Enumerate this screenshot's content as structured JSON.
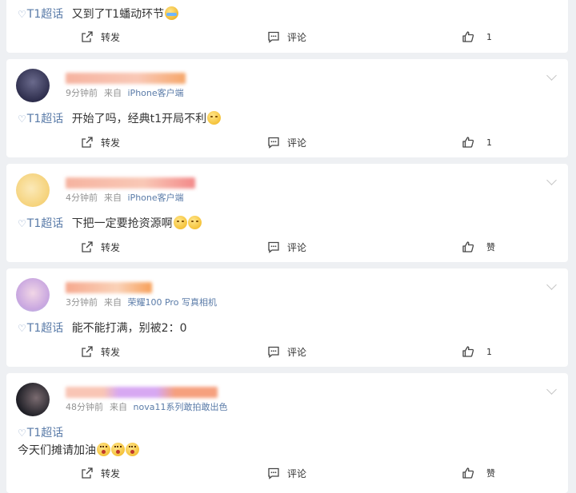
{
  "posts": [
    {
      "show_header": false,
      "text_parts": [
        {
          "kind": "topic",
          "value": "T1超话"
        },
        {
          "kind": "text",
          "value": "又到了T1蟠动环节"
        }
      ],
      "emojis": [
        "tears"
      ],
      "actions": {
        "repost": "转发",
        "comment": "评论",
        "like": "1"
      }
    },
    {
      "show_header": true,
      "time": "9分钟前",
      "from": "来自",
      "source": "iPhone客户端",
      "name_blur_colors": [
        "#f6b3a0",
        "#f9c8b6",
        "#f6a76b"
      ],
      "avatar_colors": [
        "#2b2b4a",
        "#6a6a8c"
      ],
      "text_parts": [
        {
          "kind": "topic",
          "value": "T1超话"
        },
        {
          "kind": "text",
          "value": "开始了吗，经典t1开局不利"
        }
      ],
      "emojis": [
        "smile"
      ],
      "actions": {
        "repost": "转发",
        "comment": "评论",
        "like": "1"
      }
    },
    {
      "show_header": true,
      "time": "4分钟前",
      "from": "来自",
      "source": "iPhone客户端",
      "name_blur_colors": [
        "#f6b3a0",
        "#f9c8b6",
        "#f38a8a"
      ],
      "avatar_colors": [
        "#f5d27a",
        "#fbe9b8"
      ],
      "text_parts": [
        {
          "kind": "topic",
          "value": "T1超话"
        },
        {
          "kind": "text",
          "value": "下把一定要抢资源啊"
        }
      ],
      "emojis": [
        "smile",
        "smile"
      ],
      "actions": {
        "repost": "转发",
        "comment": "评论",
        "like": "赞"
      }
    },
    {
      "show_header": true,
      "time": "3分钟前",
      "from": "来自",
      "source": "荣耀100 Pro 写真相机",
      "name_blur_colors": [
        "#f6a98f",
        "#fad2b8",
        "#f7a05a"
      ],
      "avatar_colors": [
        "#c9a7e0",
        "#f1d6e6"
      ],
      "text_parts": [
        {
          "kind": "topic",
          "value": "T1超话"
        },
        {
          "kind": "text",
          "value": "能不能打满，别被2：0"
        }
      ],
      "emojis": [],
      "actions": {
        "repost": "转发",
        "comment": "评论",
        "like": "1"
      }
    },
    {
      "show_header": true,
      "time": "48分钟前",
      "from": "来自",
      "source": "nova11系列敢拍敢出色",
      "name_blur_colors": [
        "#f9c5b5",
        "#d7a8f2",
        "#f6a07e"
      ],
      "avatar_colors": [
        "#1f1f26",
        "#7a6b70"
      ],
      "text_parts": [
        {
          "kind": "topic",
          "value": "T1超话"
        }
      ],
      "line2": "今天们摊请加油",
      "emojis": [
        "wow",
        "wow",
        "wow"
      ],
      "actions": {
        "repost": "转发",
        "comment": "评论",
        "like": "赞"
      }
    }
  ]
}
